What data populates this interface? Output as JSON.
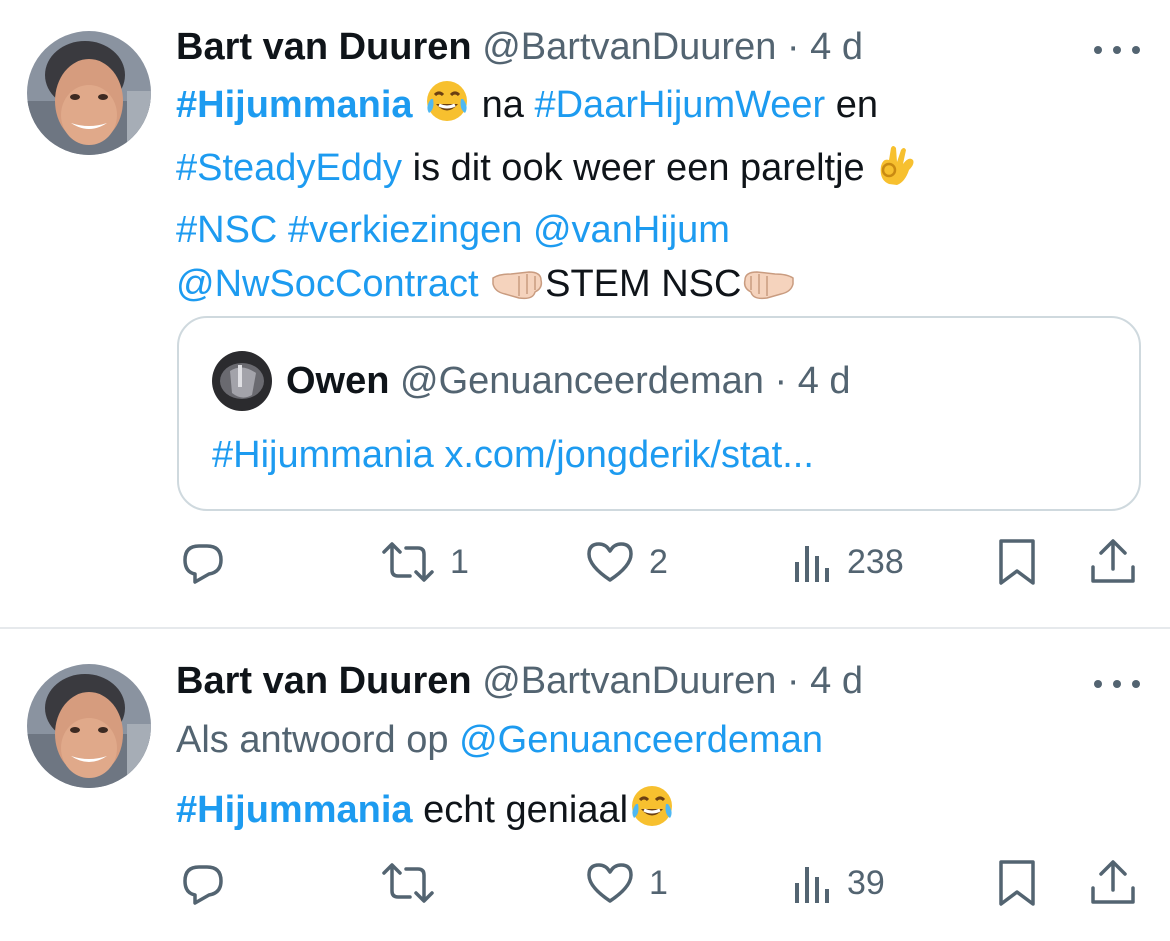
{
  "tweets": [
    {
      "author_name": "Bart van Duuren",
      "author_handle": "@BartvanDuuren",
      "separator": "·",
      "time": "4 d",
      "avatar_icon": "avatar-photo",
      "more_icon": "more-dots-icon",
      "lines": {
        "l1_tag": "#Hijummania",
        "l1_mid": " na ",
        "l1_tag2": "#DaarHijumWeer",
        "l1_end": " en",
        "l2_tag": "#SteadyEddy",
        "l2_text": " is dit ook weer een  pareltje",
        "l3_tag1": "#NSC",
        "l3_tag2": "#verkiezingen",
        "l3_mention": "@vanHijum",
        "l4_mention": "@NwSocContract",
        "l4_text": "STEM NSC"
      },
      "quote": {
        "name": "Owen",
        "handle": "@Genuanceerdeman",
        "separator": "·",
        "time": "4 d",
        "tag": "#Hijummania",
        "link": "x.com/jongderik/stat..."
      },
      "stats": {
        "reposts": "1",
        "likes": "2",
        "views": "238"
      }
    },
    {
      "author_name": "Bart van Duuren",
      "author_handle": "@BartvanDuuren",
      "separator": "·",
      "time": "4 d",
      "reply_prefix": "Als antwoord op ",
      "reply_to": "@Genuanceerdeman",
      "tag": "#Hijummania",
      "text": " echt geniaal",
      "stats": {
        "likes": "1",
        "views": "39"
      }
    }
  ],
  "colors": {
    "link": "#1d9bf0",
    "secondary": "#536471",
    "primary": "#0f1419",
    "border": "#cfd9de"
  }
}
